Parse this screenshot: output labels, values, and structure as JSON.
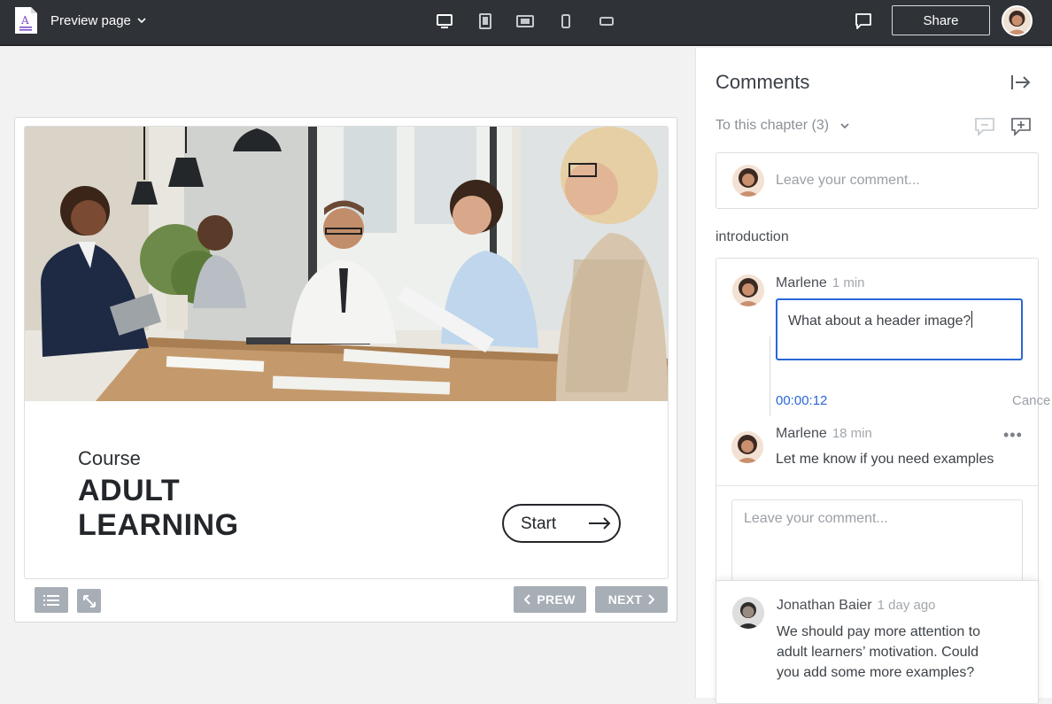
{
  "topbar": {
    "app_title": "Preview page",
    "devices": [
      "desktop",
      "tablet-portrait",
      "tablet-landscape",
      "phone-portrait",
      "phone-landscape"
    ],
    "share_label": "Share"
  },
  "preview": {
    "course_kicker": "Course",
    "course_title_line1": "ADULT",
    "course_title_line2": "LEARNING",
    "start_label": "Start",
    "prev_label": "PREW",
    "next_label": "NEXT"
  },
  "comments": {
    "title": "Comments",
    "filter_label": "To this chapter (3)",
    "new_comment_placeholder": "Leave your comment...",
    "section_label": "introduction",
    "thread": {
      "first": {
        "author": "Marlene",
        "time": "1 min",
        "edit_text": "What about a header image?",
        "timer": "00:00:12",
        "cancel_label": "Cance"
      },
      "reply": {
        "author": "Marlene",
        "time": "18 min",
        "text": "Let me know if you need examples",
        "more": "•••"
      },
      "reply_placeholder": "Leave your comment..."
    },
    "other": {
      "author": "Jonathan Baier",
      "time": "1 day ago",
      "text_line1": "We should pay more attention to",
      "text_line2": "adult learners’ motivation. Could",
      "text_line3": "you add some more examples?"
    }
  },
  "colors": {
    "topbar_bg": "#2f3338",
    "accent_blue": "#2a67d6",
    "nav_button_bg": "#a7aeb6",
    "page_bg": "#f2f2f2"
  }
}
